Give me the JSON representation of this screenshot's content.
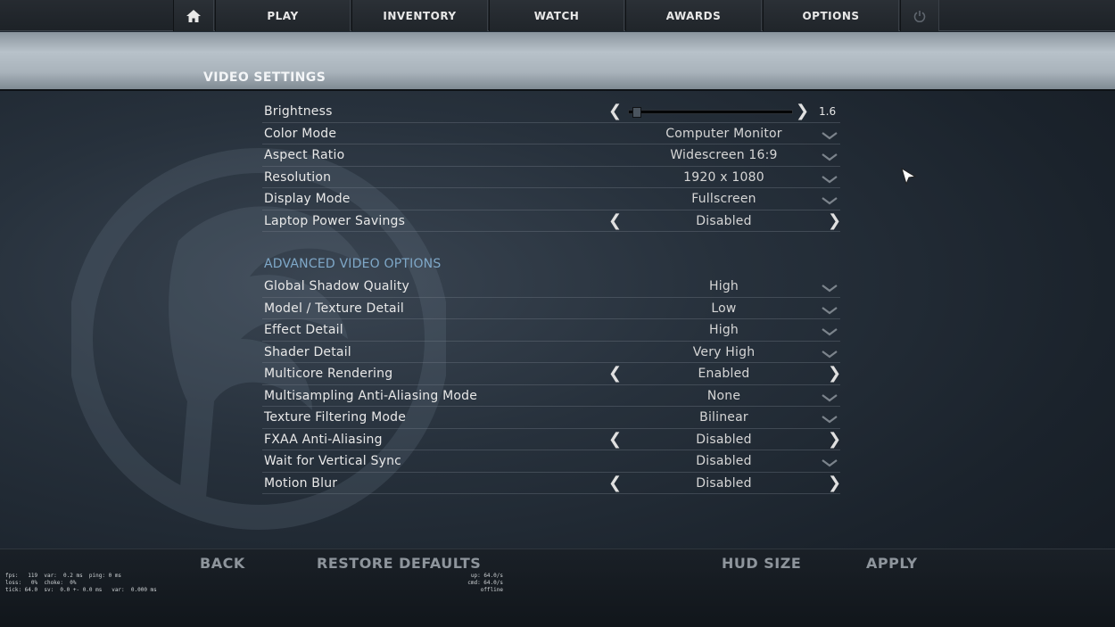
{
  "nav": {
    "home_icon": "home-icon",
    "items": [
      "PLAY",
      "INVENTORY",
      "WATCH",
      "AWARDS",
      "OPTIONS"
    ],
    "power_icon": "power-icon"
  },
  "page_title": "VIDEO SETTINGS",
  "brightness": {
    "label": "Brightness",
    "value": "1.6",
    "level": 0.02
  },
  "basic_settings": [
    {
      "label": "Color Mode",
      "value": "Computer Monitor",
      "control": "dropdown"
    },
    {
      "label": "Aspect Ratio",
      "value": "Widescreen 16:9",
      "control": "dropdown"
    },
    {
      "label": "Resolution",
      "value": "1920 x 1080",
      "control": "dropdown"
    },
    {
      "label": "Display Mode",
      "value": "Fullscreen",
      "control": "dropdown"
    },
    {
      "label": "Laptop Power Savings",
      "value": "Disabled",
      "control": "toggle"
    }
  ],
  "advanced_title": "ADVANCED VIDEO OPTIONS",
  "advanced_settings": [
    {
      "label": "Global Shadow Quality",
      "value": "High",
      "control": "dropdown"
    },
    {
      "label": "Model / Texture Detail",
      "value": "Low",
      "control": "dropdown"
    },
    {
      "label": "Effect Detail",
      "value": "High",
      "control": "dropdown"
    },
    {
      "label": "Shader Detail",
      "value": "Very High",
      "control": "dropdown"
    },
    {
      "label": "Multicore Rendering",
      "value": "Enabled",
      "control": "toggle"
    },
    {
      "label": "Multisampling Anti-Aliasing Mode",
      "value": "None",
      "control": "dropdown"
    },
    {
      "label": "Texture Filtering Mode",
      "value": "Bilinear",
      "control": "dropdown"
    },
    {
      "label": "FXAA Anti-Aliasing",
      "value": "Disabled",
      "control": "toggle"
    },
    {
      "label": "Wait for Vertical Sync",
      "value": "Disabled",
      "control": "dropdown"
    },
    {
      "label": "Motion Blur",
      "value": "Disabled",
      "control": "toggle"
    }
  ],
  "bottom": {
    "back": "BACK",
    "restore_defaults": "RESTORE DEFAULTS",
    "hud_size": "HUD SIZE",
    "apply": "APPLY"
  },
  "netgraph": {
    "left_lines": [
      "fps:   119  var:  0.2 ms  ping: 0 ms",
      "loss:   0%  choke:  0%",
      "tick: 64.0  sv:  0.0 +- 0.0 ms   var:  0.000 ms"
    ],
    "right_lines": [
      "up: 64.0/s",
      "cmd: 64.0/s",
      "offline"
    ]
  },
  "colors": {
    "accent_section": "#7fa8c8",
    "bottom_button": "#8e959c"
  }
}
